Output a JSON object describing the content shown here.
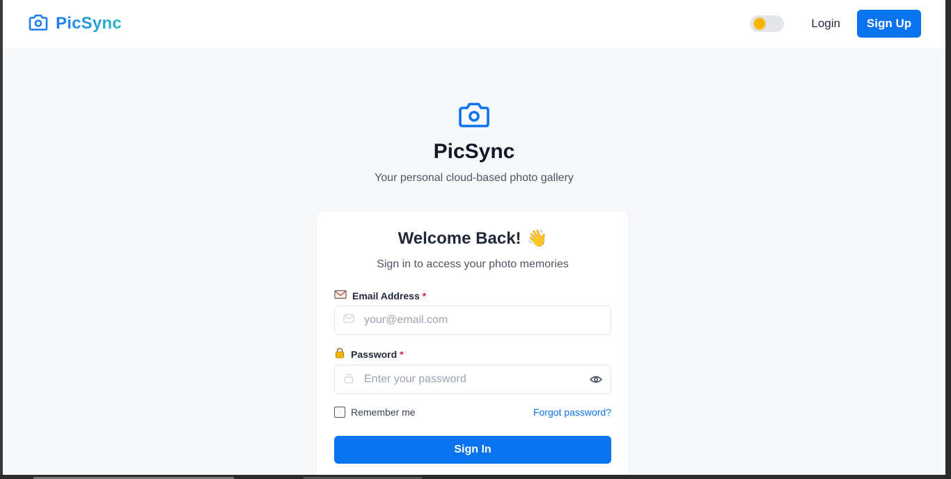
{
  "navbar": {
    "brand": "PicSync",
    "login_label": "Login",
    "signup_label": "Sign Up"
  },
  "hero": {
    "title": "PicSync",
    "subtitle": "Your personal cloud-based photo gallery"
  },
  "card": {
    "title": "Welcome Back!",
    "title_emoji": "👋",
    "subtitle": "Sign in to access your photo memories",
    "email_label": "Email Address",
    "email_placeholder": "your@email.com",
    "password_label": "Password",
    "password_placeholder": "Enter your password",
    "required_mark": "*",
    "remember_label": "Remember me",
    "forgot_label": "Forgot password?",
    "signin_label": "Sign In"
  },
  "colors": {
    "primary": "#0a74f0",
    "brand_gradient_start": "#1e7cf2",
    "brand_gradient_end": "#2bb8c8",
    "required": "#e11d48",
    "page_bg": "#f7f8fa"
  },
  "icons": {
    "brand": "camera-icon",
    "hero": "camera-icon",
    "theme": "sun-icon",
    "email_label": "envelope-emoji-icon",
    "password_label": "lock-emoji-icon",
    "email_field": "mail-icon",
    "password_field": "lock-icon",
    "toggle_visibility": "eye-icon"
  }
}
